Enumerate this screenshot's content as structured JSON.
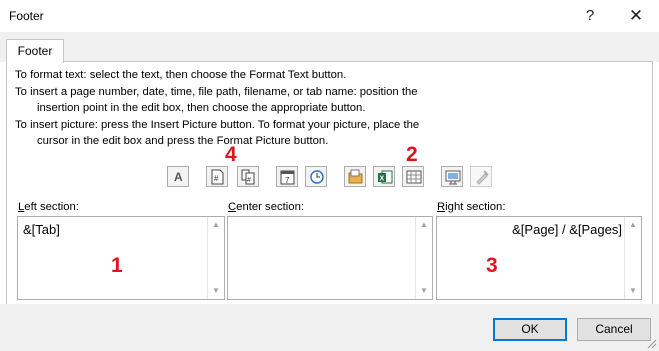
{
  "window": {
    "title": "Footer",
    "help": "?",
    "close": "✕"
  },
  "tabs": [
    {
      "label": "Footer",
      "active": true
    }
  ],
  "instructions": {
    "line1": "To format text:  select the text, then choose the Format Text button.",
    "line2": "To insert a page number, date, time, file path, filename, or tab name:  position the",
    "line3": "insertion point in the edit box, then choose the appropriate button.",
    "line4": "To insert picture: press the Insert Picture button.  To format your picture, place the",
    "line5": "cursor in the edit box and press the Format Picture button."
  },
  "toolbar": [
    {
      "name": "format-text",
      "icon": "format-text-icon",
      "enabled": true
    },
    {
      "name": "insert-page-number",
      "icon": "page-number-icon",
      "enabled": true
    },
    {
      "name": "insert-number-of-pages",
      "icon": "number-of-pages-icon",
      "enabled": true
    },
    {
      "name": "insert-date",
      "icon": "calendar-icon",
      "enabled": true
    },
    {
      "name": "insert-time",
      "icon": "clock-icon",
      "enabled": true
    },
    {
      "name": "insert-file-path",
      "icon": "folder-icon",
      "enabled": true
    },
    {
      "name": "insert-file-name",
      "icon": "excel-icon",
      "enabled": true
    },
    {
      "name": "insert-sheet-name",
      "icon": "sheet-icon",
      "enabled": true
    },
    {
      "name": "insert-picture",
      "icon": "picture-icon",
      "enabled": true
    },
    {
      "name": "format-picture",
      "icon": "format-picture-icon",
      "enabled": false
    }
  ],
  "sections": {
    "left": {
      "label_prefix": "",
      "label_underline": "L",
      "label_rest": "eft section:",
      "value": "&[Tab]"
    },
    "center": {
      "label_prefix": "",
      "label_underline": "C",
      "label_rest": "enter section:",
      "value": ""
    },
    "right": {
      "label_prefix": "",
      "label_underline": "R",
      "label_rest": "ight section:",
      "value": "&[Page]  /  &[Pages]"
    }
  },
  "markers": {
    "m1": "1",
    "m2": "2",
    "m3": "3",
    "m4": "4"
  },
  "buttons": {
    "ok": "OK",
    "cancel": "Cancel"
  },
  "colors": {
    "marker": "#e0141e",
    "ok_border": "#0078d7"
  }
}
